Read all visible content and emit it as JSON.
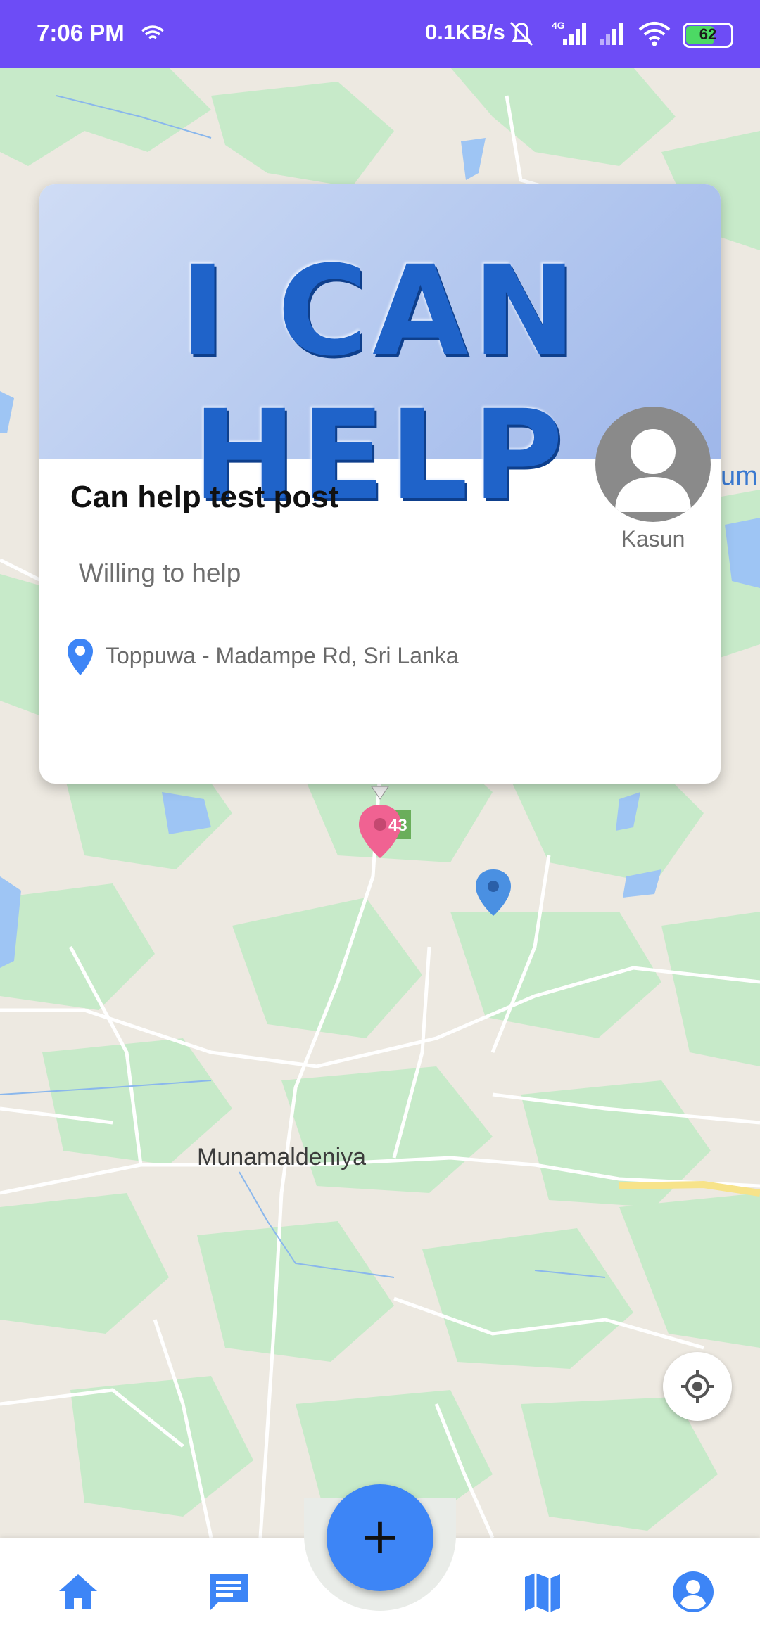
{
  "status_bar": {
    "time": "7:06 PM",
    "network_speed": "0.1KB/s",
    "network_type": "4G",
    "battery": "62"
  },
  "map": {
    "place_label": "Munamaldeniya",
    "road_shield": "43",
    "partial_label": "um"
  },
  "post_card": {
    "banner_text": "I CAN HELP",
    "title": "Can help test post",
    "description": "Willing to help",
    "location": "Toppuwa - Madampe Rd, Sri Lanka",
    "author_name": "Kasun"
  },
  "fab": {
    "label": "+"
  },
  "colors": {
    "status_bar": "#6d4cf6",
    "accent": "#3d85f6",
    "map_green": "#c7eac9",
    "map_base": "#ede9e1",
    "pink_marker": "#f06292"
  },
  "bottom_nav": {
    "items": [
      {
        "icon": "home-icon"
      },
      {
        "icon": "chat-icon"
      },
      {
        "icon": "map-icon"
      },
      {
        "icon": "account-icon"
      }
    ]
  }
}
